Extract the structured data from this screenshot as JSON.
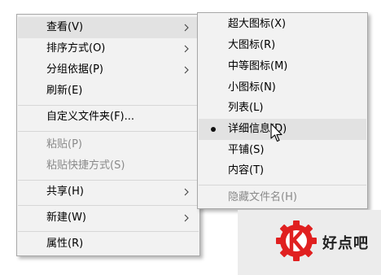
{
  "main_menu": {
    "items": [
      {
        "label": "查看(V)",
        "has_submenu": true,
        "state": "hover"
      },
      {
        "label": "排序方式(O)",
        "has_submenu": true
      },
      {
        "label": "分组依据(P)",
        "has_submenu": true
      },
      {
        "label": "刷新(E)"
      },
      {
        "label": "自定义文件夹(F)..."
      },
      {
        "label": "粘贴(P)",
        "disabled": true
      },
      {
        "label": "粘贴快捷方式(S)",
        "disabled": true
      },
      {
        "label": "共享(H)",
        "has_submenu": true
      },
      {
        "label": "新建(W)",
        "has_submenu": true
      },
      {
        "label": "属性(R)"
      }
    ]
  },
  "view_submenu": {
    "items": [
      {
        "label": "超大图标(X)"
      },
      {
        "label": "大图标(R)"
      },
      {
        "label": "中等图标(M)"
      },
      {
        "label": "小图标(N)"
      },
      {
        "label": "列表(L)"
      },
      {
        "label": "详细信息(D)",
        "selected": true,
        "state": "hover"
      },
      {
        "label": "平铺(S)"
      },
      {
        "label": "内容(T)"
      },
      {
        "label": "隐藏文件名(H)",
        "disabled": true
      }
    ]
  },
  "watermark": {
    "text": "好点吧",
    "logo_color": "#e02020"
  },
  "colors": {
    "menu_background": "#f2f2f2",
    "hover_background": "#e2e2e2",
    "disabled_text": "#8a8a8a",
    "separator": "#d7d7d7"
  }
}
